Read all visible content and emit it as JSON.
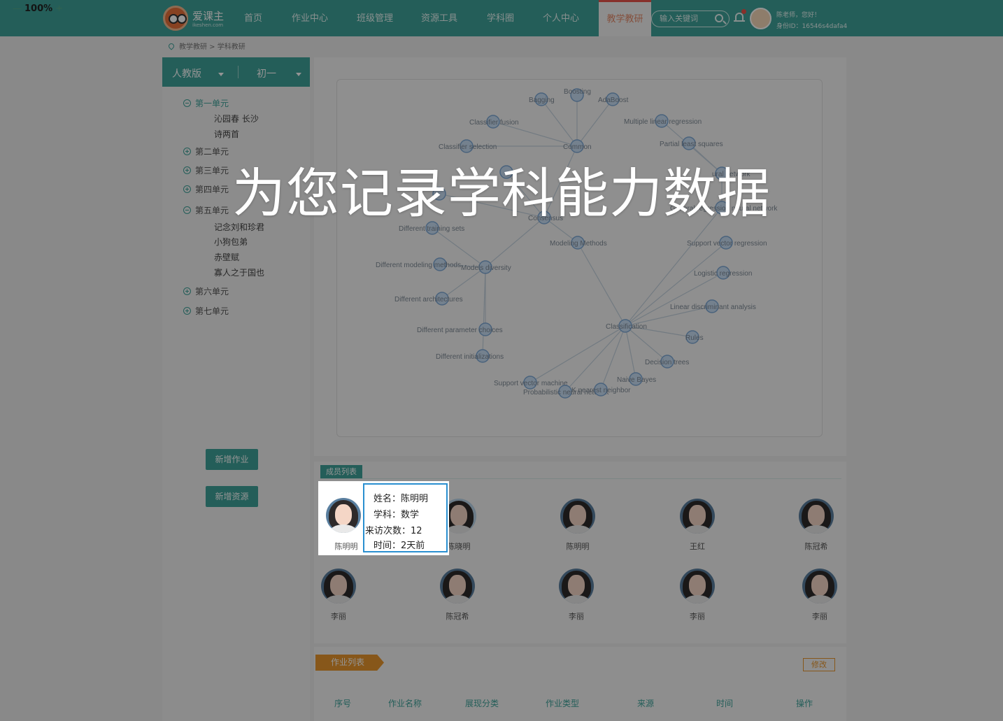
{
  "zoom": {
    "minus": "—",
    "value": "100%",
    "plus": "+"
  },
  "brand": {
    "name": "爱课主",
    "sub": "ikeshen.com"
  },
  "nav": [
    {
      "label": "首页"
    },
    {
      "label": "作业中心"
    },
    {
      "label": "班级管理"
    },
    {
      "label": "资源工具"
    },
    {
      "label": "学科圈"
    },
    {
      "label": "个人中心"
    },
    {
      "label": "教学教研"
    }
  ],
  "search": {
    "placeholder": "输入关键词"
  },
  "user": {
    "greeting": "陈老师，您好！",
    "id": "身份ID：16546s4dafa4"
  },
  "breadcrumb": "教学教研 > 学科教研",
  "selectors": {
    "edition": "人教版",
    "grade": "初一"
  },
  "tree": {
    "units": [
      {
        "label": "第一单元"
      },
      {
        "label": "第二单元"
      },
      {
        "label": "第三单元"
      },
      {
        "label": "第四单元"
      },
      {
        "label": "第五单元"
      },
      {
        "label": "第六单元"
      },
      {
        "label": "第七单元"
      }
    ],
    "lessons_unit1": [
      "沁园春 长沙",
      "诗两首"
    ],
    "lessons_unit5": [
      "记念刘和珍君",
      "小狗包弟",
      "赤壁赋",
      "寡人之于国也"
    ]
  },
  "buttons": {
    "add_homework": "新增作业",
    "add_resource": "新增资源",
    "edit": "修改"
  },
  "graph": {
    "nodes": [
      {
        "id": "bagging",
        "label": "Bagging"
      },
      {
        "id": "boosting",
        "label": "Boosting"
      },
      {
        "id": "adaboost",
        "label": "AdaBoost"
      },
      {
        "id": "fusion",
        "label": "Classifier fusion"
      },
      {
        "id": "mlr",
        "label": "Multiple linear regression"
      },
      {
        "id": "selection",
        "label": "Classifier selection"
      },
      {
        "id": "common",
        "label": "Common"
      },
      {
        "id": "pls",
        "label": "Partial least squares"
      },
      {
        "id": "nn",
        "label": "ural network"
      },
      {
        "id": "grnn",
        "label": "General regression neural network"
      },
      {
        "id": "consensus",
        "label": "Consensus"
      },
      {
        "id": "dts",
        "label": "Different training sets"
      },
      {
        "id": "modeling",
        "label": "Modeling Methods"
      },
      {
        "id": "svr",
        "label": "Support vector regression"
      },
      {
        "id": "dmm",
        "label": "Different modeling methods"
      },
      {
        "id": "diversity",
        "label": "Models diversity"
      },
      {
        "id": "logistic",
        "label": "Logistic regression"
      },
      {
        "id": "arch",
        "label": "Different architectures"
      },
      {
        "id": "lda",
        "label": "Linear discriminant analysis"
      },
      {
        "id": "classification",
        "label": "Classification"
      },
      {
        "id": "param",
        "label": "Different parameter choices"
      },
      {
        "id": "rules",
        "label": "Rules"
      },
      {
        "id": "init",
        "label": "Different initializations"
      },
      {
        "id": "dtree",
        "label": "Decision trees"
      },
      {
        "id": "bayes",
        "label": "Naive Bayes"
      },
      {
        "id": "svm",
        "label": "Support vector machine"
      },
      {
        "id": "pnn",
        "label": "Probabilistic neural network"
      },
      {
        "id": "knn",
        "label": "K nearest neighbor"
      },
      {
        "id": "cf2",
        "label": ""
      },
      {
        "id": "mo",
        "label": ""
      }
    ]
  },
  "members_title": "成员列表",
  "members": [
    {
      "name": "陈明明"
    },
    {
      "name": "陈晓明"
    },
    {
      "name": "陈明明"
    },
    {
      "name": "王红"
    },
    {
      "name": "陈冠希"
    },
    {
      "name": "李丽"
    },
    {
      "name": "陈冠希"
    },
    {
      "name": "李丽"
    },
    {
      "name": "李丽"
    },
    {
      "name": "李丽"
    }
  ],
  "hover_info": {
    "name": "姓名：陈明明",
    "subject": "学科：数学",
    "visits": "来访次数：12",
    "time": "时间：2天前"
  },
  "homework_title": "作业列表",
  "columns": [
    "序号",
    "作业名称",
    "展现分类",
    "作业类型",
    "来源",
    "时间",
    "操作"
  ],
  "headline": "为您记录学科能力数据",
  "colors": {
    "teal": "#3fa39a",
    "orange": "#e8972e",
    "red": "#e9544a"
  }
}
